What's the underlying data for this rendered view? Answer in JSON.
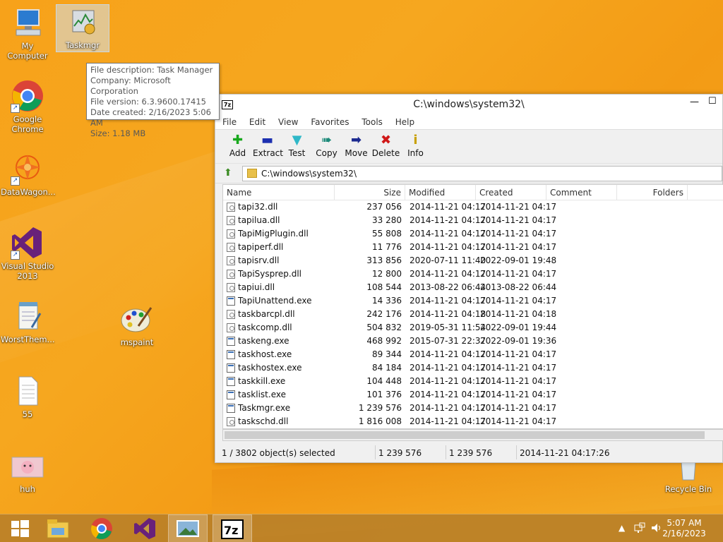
{
  "desktop": {
    "icons": [
      {
        "label": "My Computer"
      },
      {
        "label": "Taskmgr"
      },
      {
        "label": "Google Chrome"
      },
      {
        "label": "DataWagon..."
      },
      {
        "label": "Visual Studio 2013"
      },
      {
        "label": "WorstThem..."
      },
      {
        "label": "mspaint"
      },
      {
        "label": "55"
      },
      {
        "label": "huh"
      },
      {
        "label": "Recycle Bin"
      }
    ],
    "tooltip": {
      "line1": "File description: Task Manager",
      "line2": "Company: Microsoft Corporation",
      "line3": "File version: 6.3.9600.17415",
      "line4": "Date created: 2/16/2023 5:06 AM",
      "line5": "Size: 1.18 MB"
    }
  },
  "window": {
    "app_icon": "7z",
    "title": "C:\\windows\\system32\\",
    "menu": [
      "File",
      "Edit",
      "View",
      "Favorites",
      "Tools",
      "Help"
    ],
    "toolbar": [
      {
        "label": "Add",
        "icon": "plus-icon",
        "glyph": "✚",
        "color": "#17a81c"
      },
      {
        "label": "Extract",
        "icon": "minus-icon",
        "glyph": "▬",
        "color": "#1c2fb0"
      },
      {
        "label": "Test",
        "icon": "check-arrow-icon",
        "glyph": "▼",
        "color": "#2fb8c8"
      },
      {
        "label": "Copy",
        "icon": "copy-arrow-icon",
        "glyph": "➠",
        "color": "#1e8a7a"
      },
      {
        "label": "Move",
        "icon": "move-arrow-icon",
        "glyph": "➡",
        "color": "#1c2a90"
      },
      {
        "label": "Delete",
        "icon": "delete-x-icon",
        "glyph": "✖",
        "color": "#d01818"
      },
      {
        "label": "Info",
        "icon": "info-icon",
        "glyph": "i",
        "color": "#c8a000"
      }
    ],
    "address": "C:\\windows\\system32\\",
    "columns": {
      "name": "Name",
      "size": "Size",
      "modified": "Modified",
      "created": "Created",
      "comment": "Comment",
      "folders": "Folders"
    },
    "files": [
      {
        "name": "tapi32.dll",
        "type": "dll",
        "size": "237 056",
        "modified": "2014-11-21 04:17",
        "created": "2014-11-21 04:17"
      },
      {
        "name": "tapilua.dll",
        "type": "dll",
        "size": "33 280",
        "modified": "2014-11-21 04:17",
        "created": "2014-11-21 04:17"
      },
      {
        "name": "TapiMigPlugin.dll",
        "type": "dll",
        "size": "55 808",
        "modified": "2014-11-21 04:17",
        "created": "2014-11-21 04:17"
      },
      {
        "name": "tapiperf.dll",
        "type": "dll",
        "size": "11 776",
        "modified": "2014-11-21 04:17",
        "created": "2014-11-21 04:17"
      },
      {
        "name": "tapisrv.dll",
        "type": "dll",
        "size": "313 856",
        "modified": "2020-07-11 11:40",
        "created": "2022-09-01 19:48"
      },
      {
        "name": "TapiSysprep.dll",
        "type": "dll",
        "size": "12 800",
        "modified": "2014-11-21 04:17",
        "created": "2014-11-21 04:17"
      },
      {
        "name": "tapiui.dll",
        "type": "dll",
        "size": "108 544",
        "modified": "2013-08-22 06:44",
        "created": "2013-08-22 06:44"
      },
      {
        "name": "TapiUnattend.exe",
        "type": "exe",
        "size": "14 336",
        "modified": "2014-11-21 04:17",
        "created": "2014-11-21 04:17"
      },
      {
        "name": "taskbarcpl.dll",
        "type": "dll",
        "size": "242 176",
        "modified": "2014-11-21 04:18",
        "created": "2014-11-21 04:18"
      },
      {
        "name": "taskcomp.dll",
        "type": "dll",
        "size": "504 832",
        "modified": "2019-05-31 11:54",
        "created": "2022-09-01 19:44"
      },
      {
        "name": "taskeng.exe",
        "type": "exe",
        "size": "468 992",
        "modified": "2015-07-31 22:37",
        "created": "2022-09-01 19:36"
      },
      {
        "name": "taskhost.exe",
        "type": "exe",
        "size": "89 344",
        "modified": "2014-11-21 04:17",
        "created": "2014-11-21 04:17"
      },
      {
        "name": "taskhostex.exe",
        "type": "exe",
        "size": "84 184",
        "modified": "2014-11-21 04:17",
        "created": "2014-11-21 04:17"
      },
      {
        "name": "taskkill.exe",
        "type": "exe",
        "size": "104 448",
        "modified": "2014-11-21 04:17",
        "created": "2014-11-21 04:17"
      },
      {
        "name": "tasklist.exe",
        "type": "exe",
        "size": "101 376",
        "modified": "2014-11-21 04:17",
        "created": "2014-11-21 04:17"
      },
      {
        "name": "Taskmgr.exe",
        "type": "exe",
        "size": "1 239 576",
        "modified": "2014-11-21 04:17",
        "created": "2014-11-21 04:17"
      },
      {
        "name": "taskschd.dll",
        "type": "dll",
        "size": "1 816 008",
        "modified": "2014-11-21 04:17",
        "created": "2014-11-21 04:17"
      }
    ],
    "status": {
      "selection": "1 / 3802 object(s) selected",
      "size1": "1 239 576",
      "size2": "1 239 576",
      "date": "2014-11-21 04:17:26"
    }
  },
  "taskbar": {
    "time": "5:07 AM",
    "date": "2/16/2023"
  }
}
